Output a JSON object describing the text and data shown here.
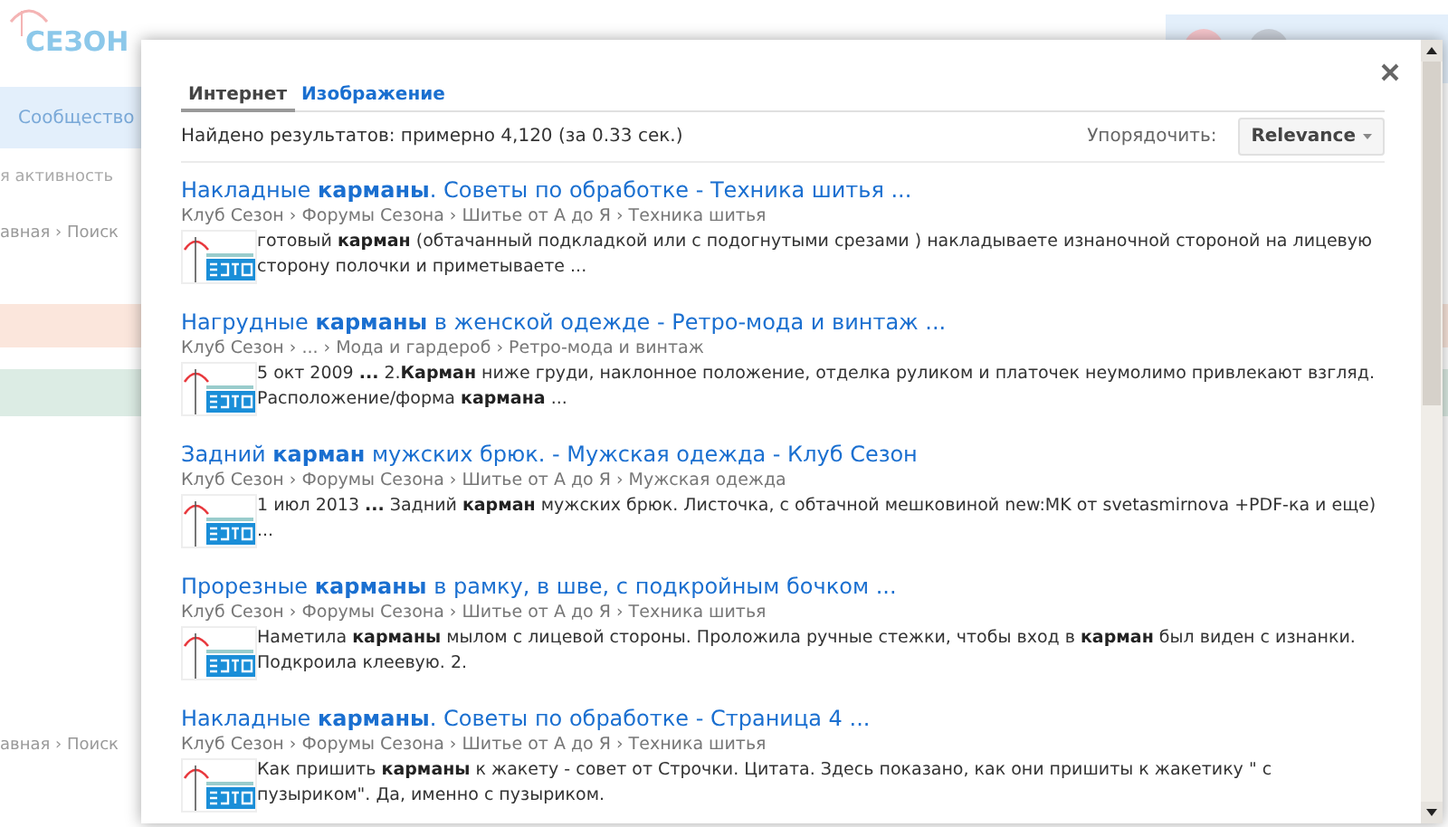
{
  "background": {
    "logo_text": "СЕЗОН",
    "nav_item": "Сообщество",
    "sidebar_link": "я активность",
    "breadcrumb_top": "авная › Поиск",
    "breadcrumb_bottom": "авная › Поиск"
  },
  "dialog": {
    "tabs": [
      {
        "label": "Интернет",
        "selected": true
      },
      {
        "label": "Изображение",
        "selected": false
      }
    ],
    "stats": "Найдено результатов: примерно 4,120 (за 0.33 сек.)",
    "sort_label": "Упорядочить:",
    "sort_value": "Relevance",
    "results": [
      {
        "title": "Накладные **карманы**. Советы по обработке - Техника шитья ...",
        "path": "Клуб Сезон › Форумы Сезона › Шитье от А до Я › Техника шитья",
        "snippet": "готовый **карман** (обтачанный подкладкой или с подогнутыми срезами ) накладываете изнаночной стороной на лицевую сторону полочки и приметываете ..."
      },
      {
        "title": "Нагрудные **карманы** в женской одежде - Ретро-мода и винтаж ...",
        "path": "Клуб Сезон › ... › Мода и гардероб › Ретро-мода и винтаж",
        "snippet": "5 окт 2009 **...** 2.**Карман** ниже груди, наклонное положение, отделка руликом и платочек неумолимо привлекают взгляд. Расположение/форма **кармана** ..."
      },
      {
        "title": "Задний **карман** мужских брюк. - Мужская одежда - Клуб Сезон",
        "path": "Клуб Сезон › Форумы Сезона › Шитье от А до Я › Мужская одежда",
        "snippet": "1 июл 2013 **...** Задний **карман** мужских брюк. Листочка, с обтачной мешковиной new:MK от svetasmirnova +PDF-ка и еще) ..."
      },
      {
        "title": "Прорезные **карманы** в рамку, в шве, с подкройным бочком ...",
        "path": "Клуб Сезон › Форумы Сезона › Шитье от А до Я › Техника шитья",
        "snippet": "Наметила **карманы** мылом с лицевой стороны. Проложила ручные стежки, чтобы вход в **карман** был виден с изнанки. Подкроила клеевую. 2."
      },
      {
        "title": "Накладные **карманы**. Советы по обработке - Страница 4 ...",
        "path": "Клуб Сезон › Форумы Сезона › Шитье от А до Я › Техника шитья",
        "snippet": "Как пришить **карманы** к жакету - совет от Строчки. Цитата. Здесь показано, как они пришиты к жакетику \" с пузыриком\". Да, именно с пузыриком."
      }
    ]
  }
}
